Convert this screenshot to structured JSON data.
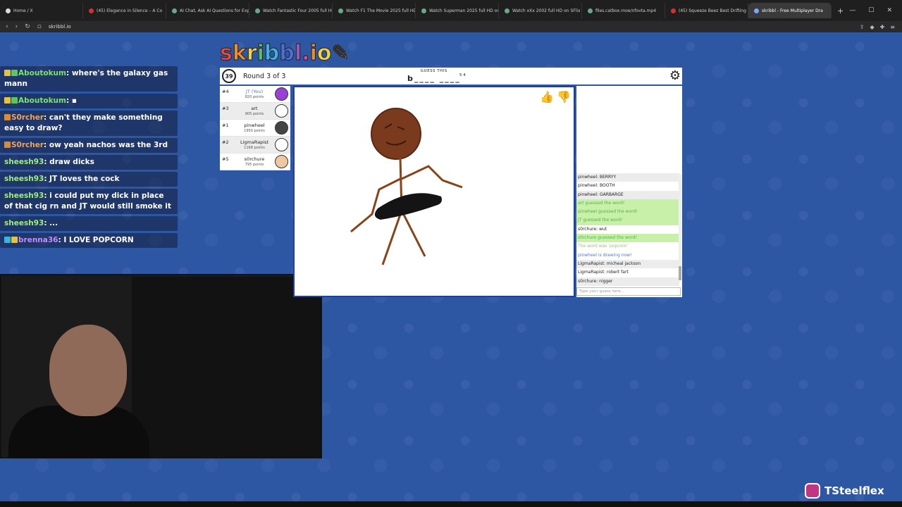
{
  "browser": {
    "tabs": [
      {
        "label": "Home / X",
        "fav": "x"
      },
      {
        "label": "(45) Elegance in Silence – A Co",
        "fav": "yt"
      },
      {
        "label": "AI Chat, Ask AI Questions for Expe",
        "fav": "g"
      },
      {
        "label": "Watch Fantastic Four 2005 full HD",
        "fav": "g"
      },
      {
        "label": "Watch F1 The Movie 2025 full HD",
        "fav": "g"
      },
      {
        "label": "Watch Superman 2025 full HD on",
        "fav": "g"
      },
      {
        "label": "Watch xXx 2002 full HD on SFlix Fr",
        "fav": "g"
      },
      {
        "label": "files.catbox.moe/nfovta.mp4",
        "fav": "g"
      },
      {
        "label": "(45) Squeeze Beez Best Drifting M",
        "fav": "yt"
      },
      {
        "label": "skribbl - Free Multiplayer Dra",
        "fav": "sk",
        "active": true
      }
    ],
    "new_tab": "+",
    "url": "skribbl.io"
  },
  "stream_chat": [
    {
      "user": "Aboutokum",
      "color": "green",
      "badges": [
        "yellow",
        "green"
      ],
      "text": "where's the galaxy gas mann"
    },
    {
      "user": "Aboutokum",
      "color": "green",
      "badges": [
        "yellow",
        "green"
      ],
      "text": "▪"
    },
    {
      "user": "S0rcher",
      "color": "orange",
      "badges": [
        "orange"
      ],
      "text": "can't they make something easy to draw?"
    },
    {
      "user": "S0rcher",
      "color": "orange",
      "badges": [
        "orange"
      ],
      "text": "ow yeah nachos was the 3rd"
    },
    {
      "user": "sheesh93",
      "color": "lgreen",
      "badges": [],
      "text": "draw dicks"
    },
    {
      "user": "sheesh93",
      "color": "lgreen",
      "badges": [],
      "text": "JT loves the cock"
    },
    {
      "user": "sheesh93",
      "color": "lgreen",
      "badges": [],
      "text": "i could put my dick in place of that cig rn and JT would still smoke it"
    },
    {
      "user": "sheesh93",
      "color": "lgreen",
      "badges": [],
      "text": "..."
    },
    {
      "user": "brenna36",
      "color": "purple",
      "badges": [
        "cyan",
        "yellow"
      ],
      "text": "I LOVE POPCORN"
    }
  ],
  "game": {
    "logo": "skribbl.io",
    "timer": "39",
    "round": "Round 3 of 3",
    "guess_label": "GUESS THIS",
    "word_hint": "b____ ____",
    "word_count": "5 4",
    "players": [
      {
        "rank": "#4",
        "name": "JT (You)",
        "points": "820 points",
        "you": true,
        "avatar": "purple"
      },
      {
        "rank": "#3",
        "name": "art",
        "points": "905 points",
        "avatar": "white"
      },
      {
        "rank": "#1",
        "name": "pinwheel",
        "points": "1950 points",
        "avatar": "dark"
      },
      {
        "rank": "#2",
        "name": "LigmaRapist",
        "points": "1168 points",
        "avatar": "white"
      },
      {
        "rank": "#5",
        "name": "s0rchure",
        "points": "795 points",
        "avatar": "tan"
      }
    ],
    "messages": [
      {
        "text": "pinwheel: BERRYY",
        "type": "alt"
      },
      {
        "text": "pinwheel: BOOTH",
        "type": "normal"
      },
      {
        "text": "pinwheel: GARBARGE",
        "type": "alt"
      },
      {
        "text": "art guessed the word!",
        "type": "correct"
      },
      {
        "text": "pinwheel guessed the word!",
        "type": "correct"
      },
      {
        "text": "JT guessed the word!",
        "type": "correct"
      },
      {
        "text": "s0rchure: wut",
        "type": "normal"
      },
      {
        "text": "s0rchure guessed the word!",
        "type": "correct"
      },
      {
        "text": "The word was 'popcorn'",
        "type": "word"
      },
      {
        "text": "pinwheel is drawing now!",
        "type": "info"
      },
      {
        "text": "LigmaRapist: micheal jackson",
        "type": "alt"
      },
      {
        "text": "LigmaRapist: robert fart",
        "type": "normal"
      },
      {
        "text": "s0rchure: nigger",
        "type": "alt"
      }
    ],
    "input_placeholder": "Type your guess here..."
  },
  "overlay": {
    "instagram_handle": "TSteelflex"
  },
  "colors": {
    "background": "#2d56a3",
    "canvas_border": "#2040a0",
    "correct_bg": "#c8f0a8"
  }
}
